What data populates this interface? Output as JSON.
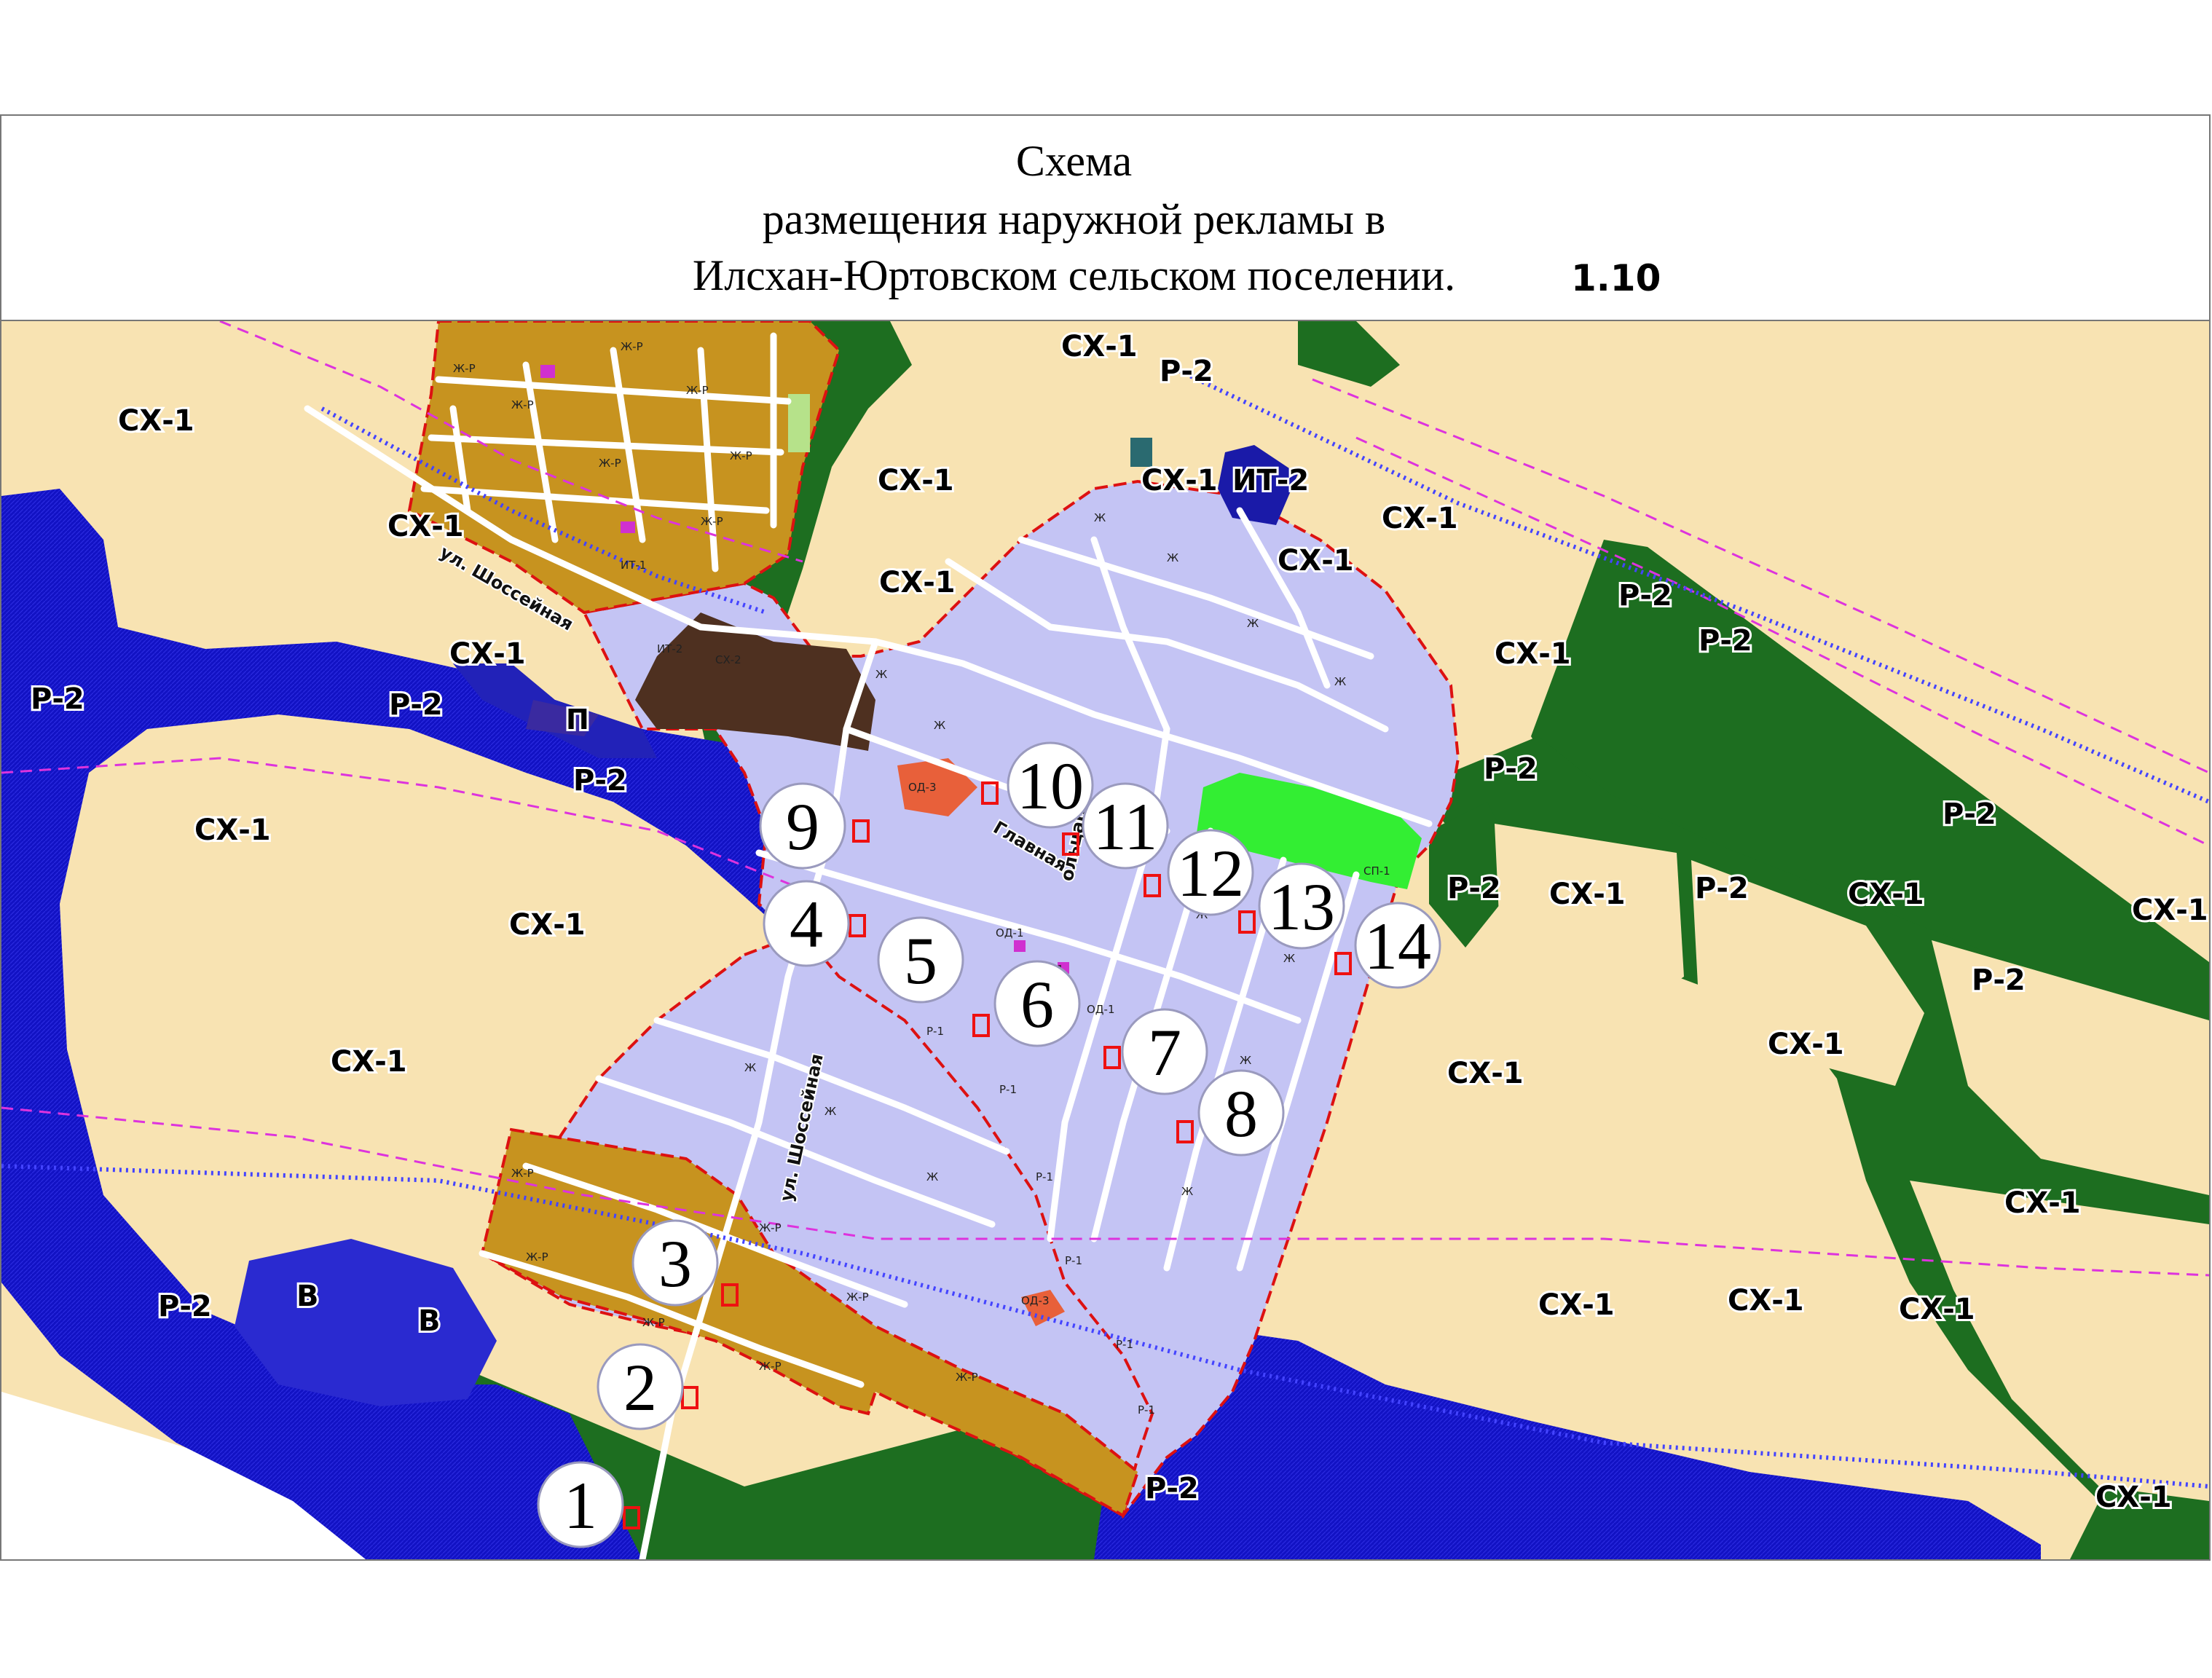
{
  "title": {
    "line1": "Схема",
    "line2": "размещения наружной рекламы в",
    "line3": "Илсхан-Юртовском сельском поселении.",
    "sheet_number": "1.10"
  },
  "colors": {
    "agriculture": "#f8e3b2",
    "recreation": "#1d6e20",
    "water": "#1414c8",
    "residential": "#c4c4f4",
    "residential_private": "#c39020",
    "industrial": "#4e3020",
    "public_business": "#e8603a",
    "green_space": "#33ee33",
    "engineering": "#1a1aa8",
    "boundary": "#dd1111",
    "roads": "#ffffff",
    "ad_site_marker": "#ee1111"
  },
  "zones": {
    "sx1": "СХ-1",
    "r2": "Р-2",
    "p": "П",
    "v": "В",
    "it2": "ИТ-2",
    "sx2": "СХ-2",
    "od3": "ОД-3",
    "od1": "ОД-1",
    "zh": "Ж",
    "zhr": "Ж-Р",
    "r1": "Р-1",
    "sp1": "СП-1",
    "it1": "ИТ-1"
  },
  "streets": {
    "shosseynaya_1": "ул. Шоссейная",
    "shosseynaya_2": "ул. Шоссейная",
    "glavnaya": "Главная",
    "partial": "ольцар"
  },
  "ad_sites": [
    "1",
    "2",
    "3",
    "4",
    "5",
    "6",
    "7",
    "8",
    "9",
    "10",
    "11",
    "12",
    "13",
    "14"
  ]
}
